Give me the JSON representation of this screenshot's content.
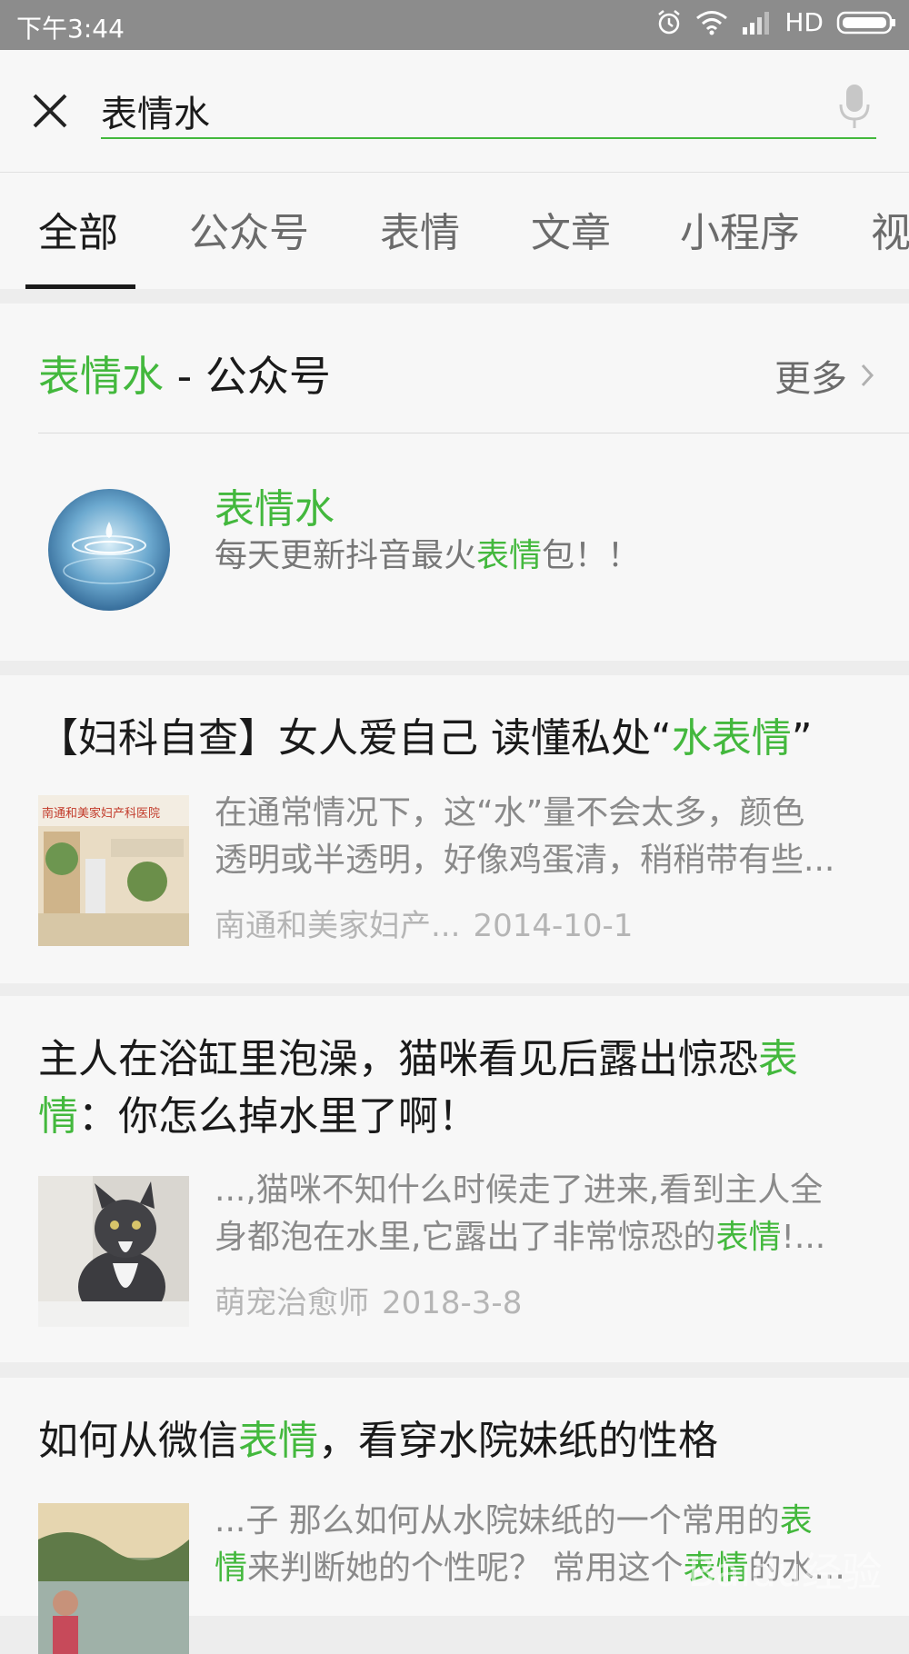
{
  "status_bar": {
    "time": "下午3:44",
    "network": "HD"
  },
  "search": {
    "query": "表情水"
  },
  "tabs": [
    {
      "label": "全部",
      "active": true
    },
    {
      "label": "公众号"
    },
    {
      "label": "表情"
    },
    {
      "label": "文章"
    },
    {
      "label": "小程序"
    },
    {
      "label": "视"
    }
  ],
  "account_section": {
    "keyword": "表情水",
    "suffix": " - 公众号",
    "more_label": "更多",
    "account": {
      "name": "表情水",
      "desc_pre": "每天更新抖音最火",
      "desc_highlight": "表情",
      "desc_post": "包！！"
    }
  },
  "articles": [
    {
      "title_pre": "【妇科自查】女人爱自己 读懂私处“",
      "title_highlight": "水表情",
      "title_post": "”",
      "snippet_line1": "在通常情况下，这“水”量不会太多，颜色",
      "snippet_line2": "透明或半透明，好像鸡蛋清，稍稍带有些...",
      "source": "南通和美家妇产...",
      "date": "2014-10-1",
      "thumb_text": "南通和美家妇产科医院"
    },
    {
      "title_pre": "主人在浴缸里泡澡，猫咪看见后露出惊恐",
      "title_highlight": "表情",
      "title_post": "：你怎么掉水里了啊！",
      "snippet_line1": "...,猫咪不知什么时候走了进来,看到主人全",
      "snippet_line2_pre": "身都泡在水里,它露出了非常惊恐的",
      "snippet_line2_hl": "表情",
      "snippet_line2_post": "!...",
      "source": "萌宠治愈师",
      "date": "2018-3-8"
    },
    {
      "title_pre": "如何从微信",
      "title_highlight": "表情",
      "title_post": "，看穿水院妹纸的性格",
      "snippet_line1_pre": "...子 那么如何从水院妹纸的一个常用的",
      "snippet_line1_hl": "表",
      "snippet_line2_hl1": "情",
      "snippet_line2_mid": "来判断她的个性呢？ 常用这个",
      "snippet_line2_hl2": "表情",
      "snippet_line2_post": "的水..."
    }
  ],
  "watermark": "Baidu经验",
  "colors": {
    "accent": "#43b83d",
    "status_bar": "#8c8c8c",
    "background": "#ededed"
  }
}
